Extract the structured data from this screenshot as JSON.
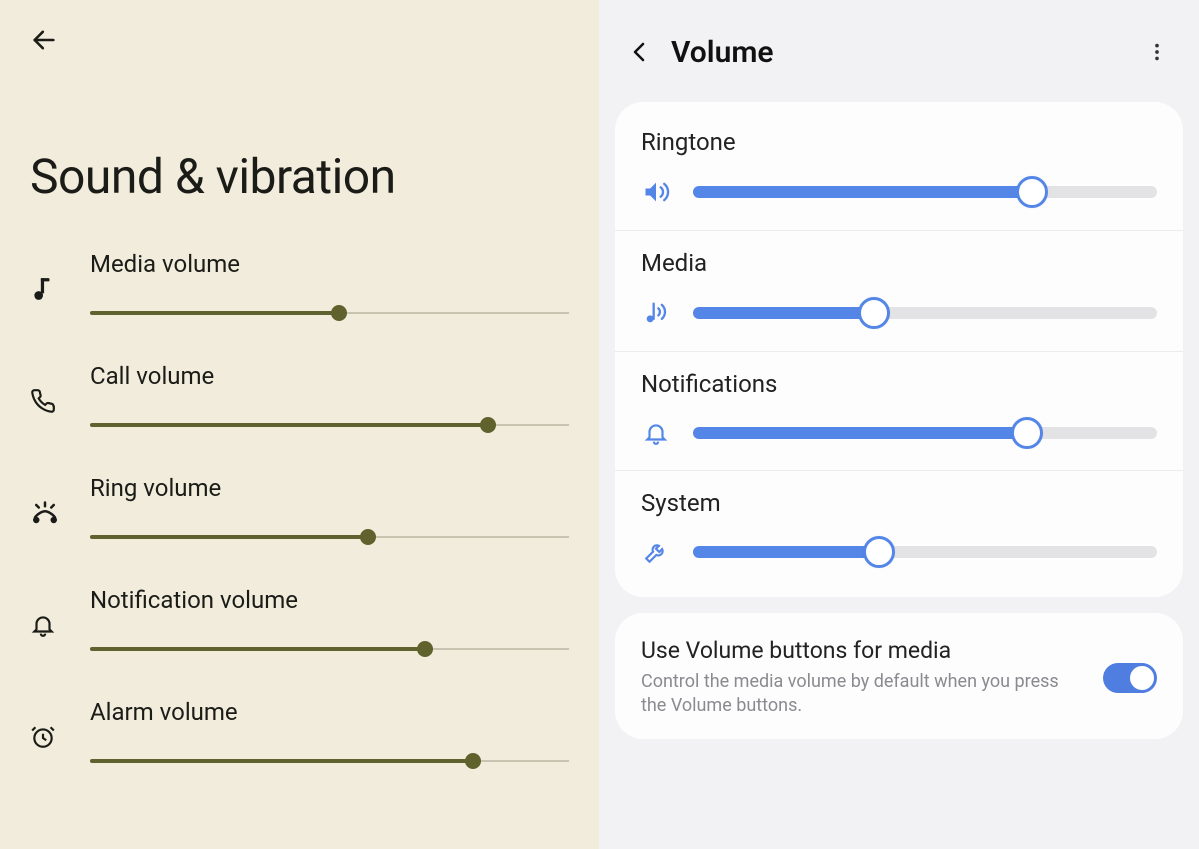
{
  "left": {
    "title": "Sound & vibration",
    "sliders": [
      {
        "id": "media",
        "label": "Media volume",
        "value": 52,
        "icon": "music-note-icon"
      },
      {
        "id": "call",
        "label": "Call volume",
        "value": 83,
        "icon": "phone-icon"
      },
      {
        "id": "ring",
        "label": "Ring volume",
        "value": 58,
        "icon": "phone-ring-icon"
      },
      {
        "id": "notification",
        "label": "Notification volume",
        "value": 70,
        "icon": "bell-icon"
      },
      {
        "id": "alarm",
        "label": "Alarm volume",
        "value": 80,
        "icon": "alarm-icon"
      }
    ]
  },
  "right": {
    "title": "Volume",
    "sliders": [
      {
        "id": "ringtone",
        "label": "Ringtone",
        "value": 73,
        "icon": "speaker-icon"
      },
      {
        "id": "media",
        "label": "Media",
        "value": 39,
        "icon": "music-waves-icon"
      },
      {
        "id": "notifications",
        "label": "Notifications",
        "value": 72,
        "icon": "bell-outline-icon"
      },
      {
        "id": "system",
        "label": "System",
        "value": 40,
        "icon": "wrench-icon"
      }
    ],
    "toggle": {
      "title": "Use Volume buttons for media",
      "subtitle": "Control the media volume by default when you press the Volume buttons.",
      "on": true
    }
  },
  "colors": {
    "left_bg": "#f1ecdc",
    "left_accent": "#60622d",
    "right_bg": "#f2f2f4",
    "right_accent": "#5486e8"
  }
}
